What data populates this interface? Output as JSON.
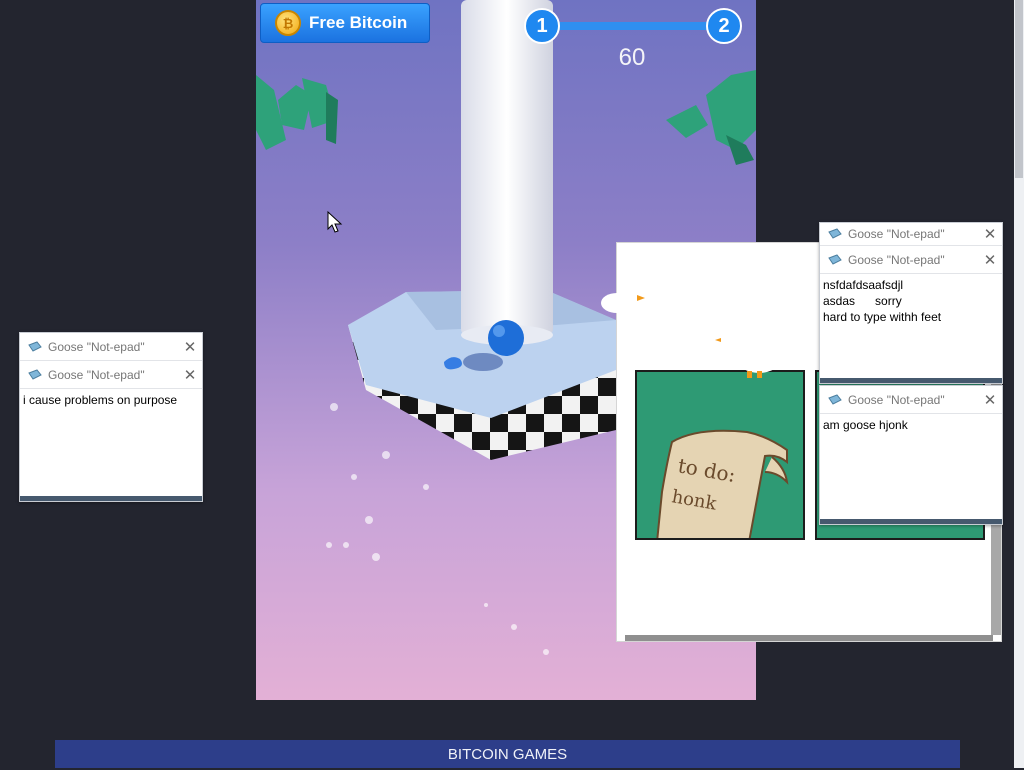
{
  "game": {
    "bitcoin_button": "Free Bitcoin",
    "coin_symbol": "₿",
    "level_current": "1",
    "level_next": "2",
    "score": "60"
  },
  "comic": {
    "note_line1": "to do:",
    "note_line2": "honk"
  },
  "notepads": [
    {
      "title": "Goose \"Not-epad\"",
      "text": "i cause problems on purpose"
    },
    {
      "title": "Goose \"Not-epad\"",
      "text": ""
    },
    {
      "title": "Goose \"Not-epad\"",
      "text": ""
    },
    {
      "title": "Goose \"Not-epad\"",
      "text": "nsfdafdsaafsdjl\nasdas      sorry\nhard to type withh feet"
    },
    {
      "title": "Goose \"Not-epad\"",
      "text": "am goose hjonk"
    }
  ],
  "close_glyph": "✕",
  "footer": {
    "label": "BITCOIN GAMES"
  },
  "colors": {
    "accent": "#2f8ff0",
    "banner": "#2d3e8a",
    "comic_green": "#2e9a74"
  }
}
